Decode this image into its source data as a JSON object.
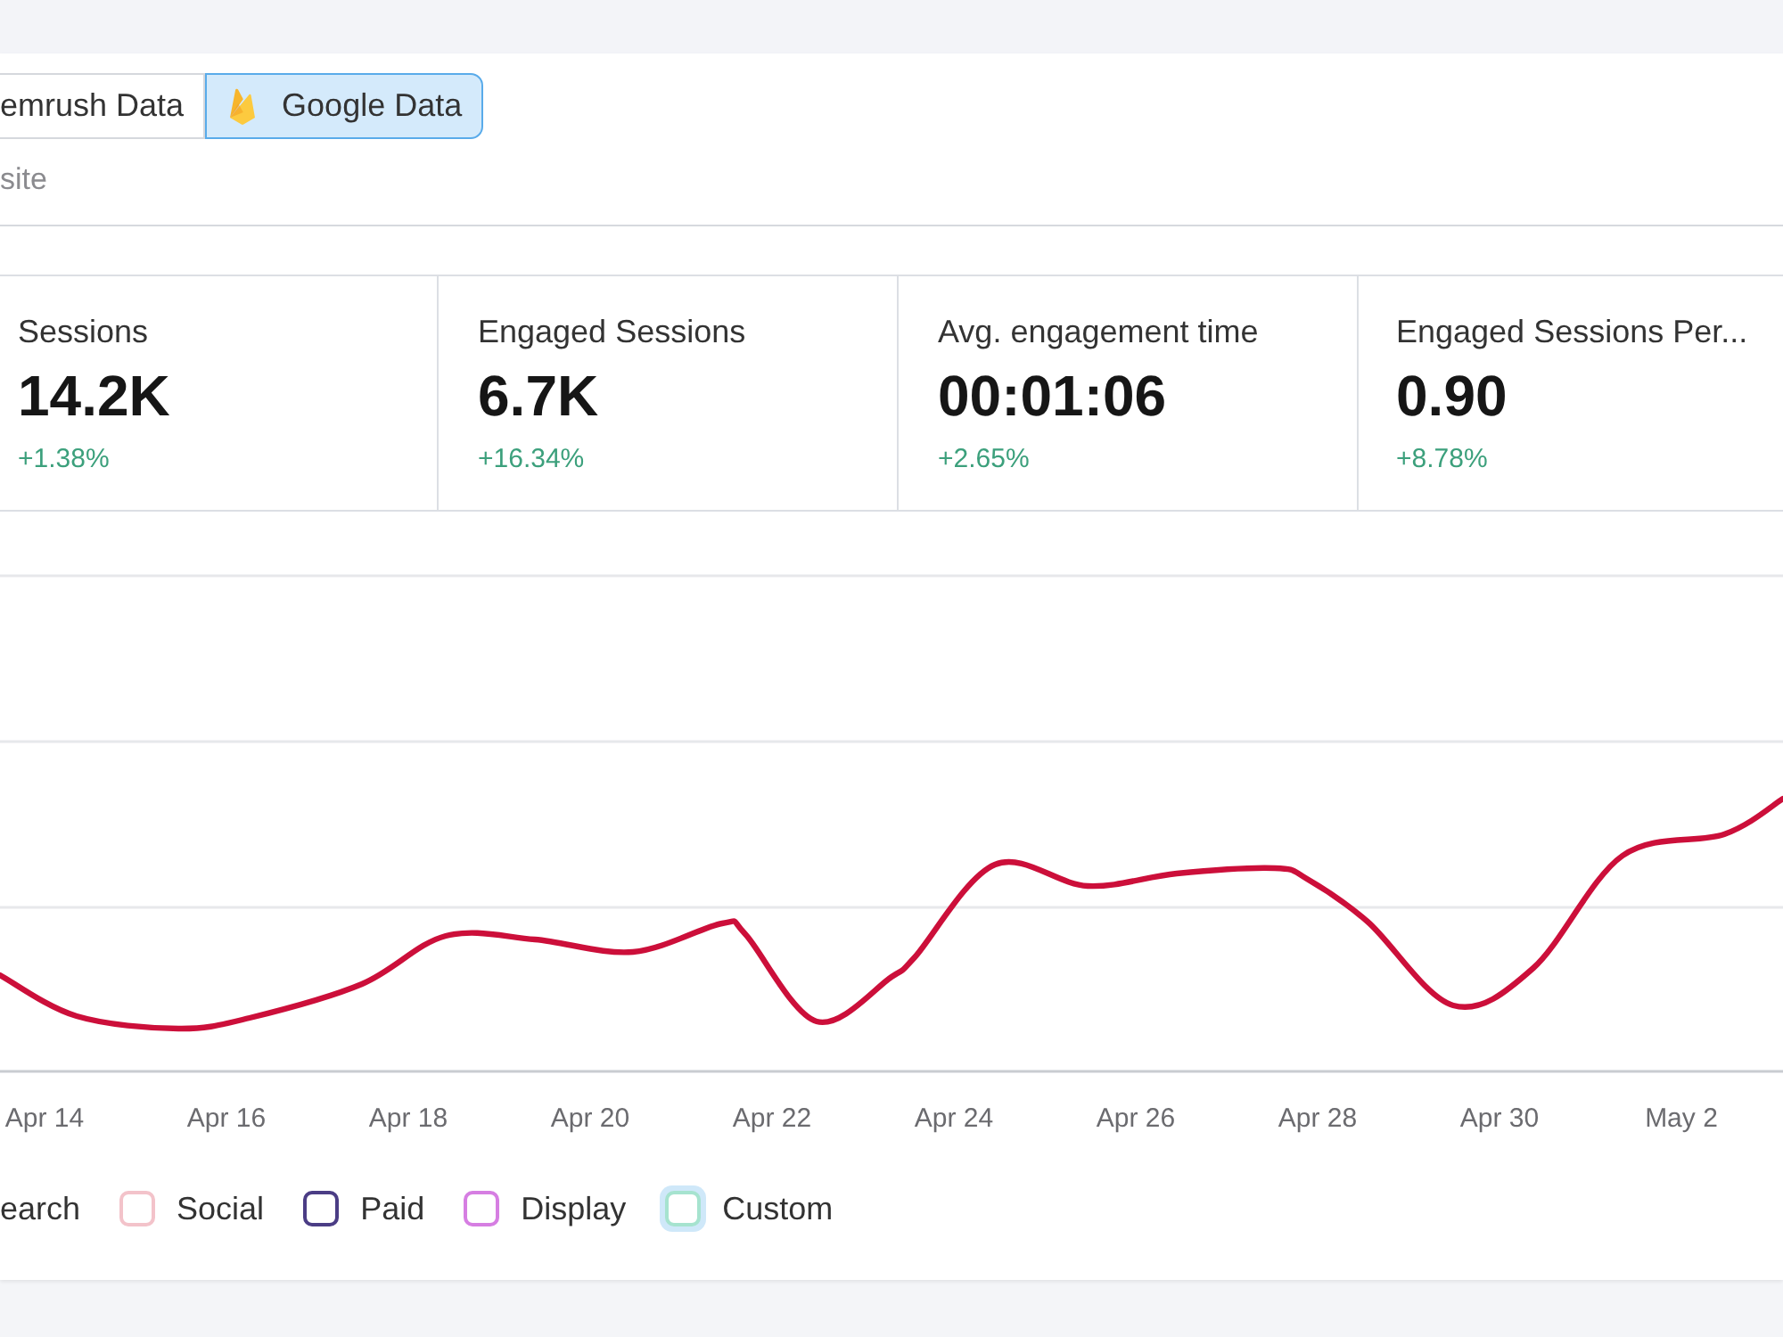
{
  "source_toggle": [
    {
      "label": "emrush Data",
      "kind": "plain",
      "selected": false
    },
    {
      "label": "Google Data",
      "kind": "icon",
      "selected": true
    }
  ],
  "subtitle": "site",
  "metrics": [
    {
      "label": "Sessions",
      "value": "14.2K",
      "change": "+1.38%"
    },
    {
      "label": "Engaged Sessions",
      "value": "6.7K",
      "change": "+16.34%"
    },
    {
      "label": "Avg. engagement time",
      "value": "00:01:06",
      "change": "+2.65%"
    },
    {
      "label": "Engaged Sessions Per...",
      "value": "0.90",
      "change": "+8.78%"
    }
  ],
  "chart": {
    "x_labels": [
      "Apr 14",
      "Apr 16",
      "Apr 18",
      "Apr 20",
      "Apr 22",
      "Apr 24",
      "Apr 26",
      "Apr 28",
      "Apr 30",
      "May 2"
    ]
  },
  "legend": [
    {
      "kind": "text",
      "label": "earch"
    },
    {
      "kind": "checkbox",
      "label": "Social",
      "checked": false,
      "focused": false,
      "color": "#f3c3ca"
    },
    {
      "kind": "checkbox",
      "label": "Paid",
      "checked": false,
      "focused": false,
      "color": "#4b3d85"
    },
    {
      "kind": "checkbox",
      "label": "Display",
      "checked": false,
      "focused": false,
      "color": "#d67ee2"
    },
    {
      "kind": "checkbox",
      "label": "Custom",
      "checked": false,
      "focused": true,
      "color": "#a6e3cf"
    }
  ]
}
